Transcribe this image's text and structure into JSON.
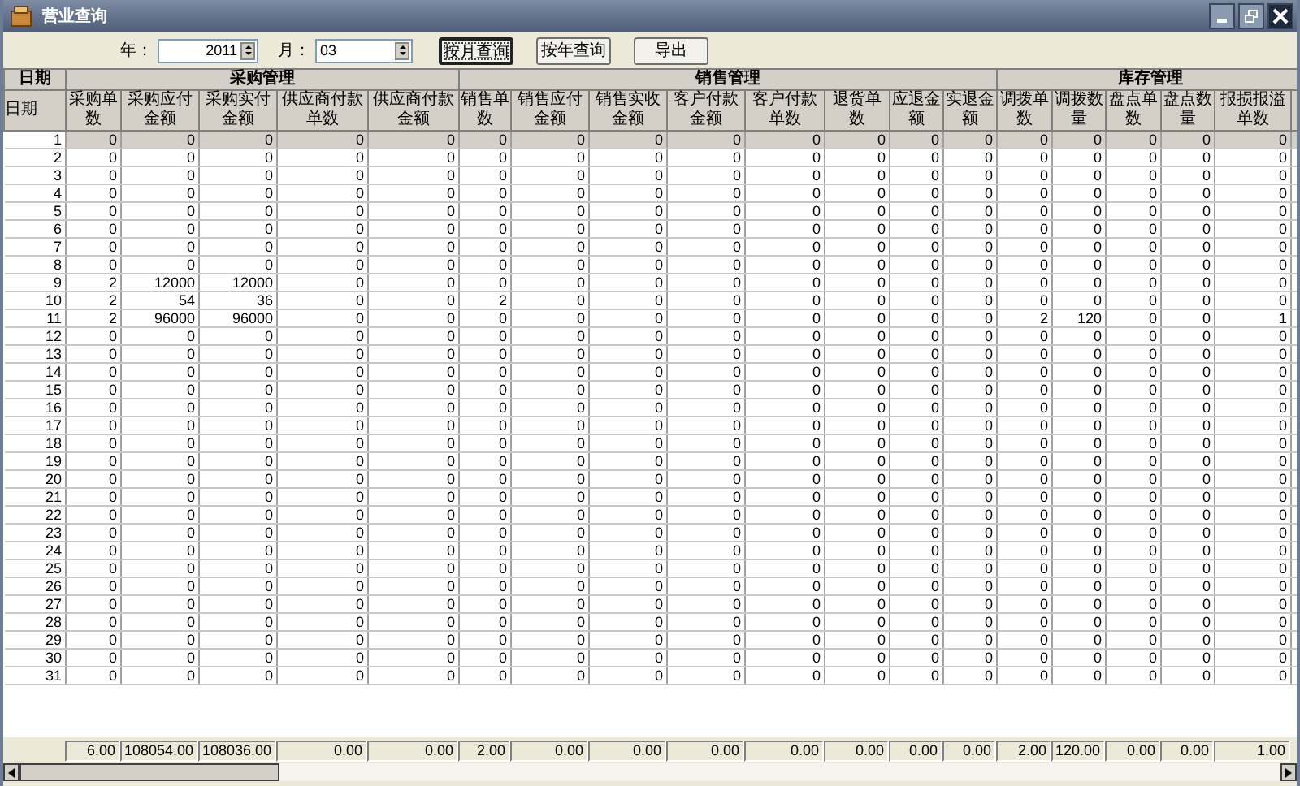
{
  "window": {
    "title": "营业查询"
  },
  "toolbar": {
    "year_label": "年：",
    "year_value": "2011",
    "month_label": "月：",
    "month_value": "03",
    "buttons": [
      {
        "label": "按月查询",
        "focused": true
      },
      {
        "label": "按年查询",
        "focused": false
      },
      {
        "label": "导出",
        "focused": false
      }
    ]
  },
  "table": {
    "groups": [
      {
        "label": "日期",
        "columns": [
          "日期"
        ]
      },
      {
        "label": "采购管理",
        "columns": [
          "采购单数",
          "采购应付金额",
          "采购实付金额",
          "供应商付款单数",
          "供应商付款金额"
        ]
      },
      {
        "label": "销售管理",
        "columns": [
          "销售单数",
          "销售应付金额",
          "销售实收金额",
          "客户付款金额",
          "客户付款单数",
          "退货单数",
          "应退金额",
          "实退金额"
        ]
      },
      {
        "label": "库存管理",
        "columns": [
          "调拨单数",
          "调拨数量",
          "盘点单数",
          "盘点数量",
          "报损报溢单数"
        ]
      }
    ],
    "rows": [
      {
        "selected": true,
        "cells": [
          "1",
          "0",
          "0",
          "0",
          "0",
          "0",
          "0",
          "0",
          "0",
          "0",
          "0",
          "0",
          "0",
          "0",
          "0",
          "0",
          "0",
          "0",
          "0"
        ]
      },
      {
        "selected": false,
        "cells": [
          "2",
          "0",
          "0",
          "0",
          "0",
          "0",
          "0",
          "0",
          "0",
          "0",
          "0",
          "0",
          "0",
          "0",
          "0",
          "0",
          "0",
          "0",
          "0"
        ]
      },
      {
        "selected": false,
        "cells": [
          "3",
          "0",
          "0",
          "0",
          "0",
          "0",
          "0",
          "0",
          "0",
          "0",
          "0",
          "0",
          "0",
          "0",
          "0",
          "0",
          "0",
          "0",
          "0"
        ]
      },
      {
        "selected": false,
        "cells": [
          "4",
          "0",
          "0",
          "0",
          "0",
          "0",
          "0",
          "0",
          "0",
          "0",
          "0",
          "0",
          "0",
          "0",
          "0",
          "0",
          "0",
          "0",
          "0"
        ]
      },
      {
        "selected": false,
        "cells": [
          "5",
          "0",
          "0",
          "0",
          "0",
          "0",
          "0",
          "0",
          "0",
          "0",
          "0",
          "0",
          "0",
          "0",
          "0",
          "0",
          "0",
          "0",
          "0"
        ]
      },
      {
        "selected": false,
        "cells": [
          "6",
          "0",
          "0",
          "0",
          "0",
          "0",
          "0",
          "0",
          "0",
          "0",
          "0",
          "0",
          "0",
          "0",
          "0",
          "0",
          "0",
          "0",
          "0"
        ]
      },
      {
        "selected": false,
        "cells": [
          "7",
          "0",
          "0",
          "0",
          "0",
          "0",
          "0",
          "0",
          "0",
          "0",
          "0",
          "0",
          "0",
          "0",
          "0",
          "0",
          "0",
          "0",
          "0"
        ]
      },
      {
        "selected": false,
        "cells": [
          "8",
          "0",
          "0",
          "0",
          "0",
          "0",
          "0",
          "0",
          "0",
          "0",
          "0",
          "0",
          "0",
          "0",
          "0",
          "0",
          "0",
          "0",
          "0"
        ]
      },
      {
        "selected": false,
        "cells": [
          "9",
          "2",
          "12000",
          "12000",
          "0",
          "0",
          "0",
          "0",
          "0",
          "0",
          "0",
          "0",
          "0",
          "0",
          "0",
          "0",
          "0",
          "0",
          "0"
        ]
      },
      {
        "selected": false,
        "cells": [
          "10",
          "2",
          "54",
          "36",
          "0",
          "0",
          "2",
          "0",
          "0",
          "0",
          "0",
          "0",
          "0",
          "0",
          "0",
          "0",
          "0",
          "0",
          "0"
        ]
      },
      {
        "selected": false,
        "cells": [
          "11",
          "2",
          "96000",
          "96000",
          "0",
          "0",
          "0",
          "0",
          "0",
          "0",
          "0",
          "0",
          "0",
          "0",
          "2",
          "120",
          "0",
          "0",
          "1"
        ]
      },
      {
        "selected": false,
        "cells": [
          "12",
          "0",
          "0",
          "0",
          "0",
          "0",
          "0",
          "0",
          "0",
          "0",
          "0",
          "0",
          "0",
          "0",
          "0",
          "0",
          "0",
          "0",
          "0"
        ]
      },
      {
        "selected": false,
        "cells": [
          "13",
          "0",
          "0",
          "0",
          "0",
          "0",
          "0",
          "0",
          "0",
          "0",
          "0",
          "0",
          "0",
          "0",
          "0",
          "0",
          "0",
          "0",
          "0"
        ]
      },
      {
        "selected": false,
        "cells": [
          "14",
          "0",
          "0",
          "0",
          "0",
          "0",
          "0",
          "0",
          "0",
          "0",
          "0",
          "0",
          "0",
          "0",
          "0",
          "0",
          "0",
          "0",
          "0"
        ]
      },
      {
        "selected": false,
        "cells": [
          "15",
          "0",
          "0",
          "0",
          "0",
          "0",
          "0",
          "0",
          "0",
          "0",
          "0",
          "0",
          "0",
          "0",
          "0",
          "0",
          "0",
          "0",
          "0"
        ]
      },
      {
        "selected": false,
        "cells": [
          "16",
          "0",
          "0",
          "0",
          "0",
          "0",
          "0",
          "0",
          "0",
          "0",
          "0",
          "0",
          "0",
          "0",
          "0",
          "0",
          "0",
          "0",
          "0"
        ]
      },
      {
        "selected": false,
        "cells": [
          "17",
          "0",
          "0",
          "0",
          "0",
          "0",
          "0",
          "0",
          "0",
          "0",
          "0",
          "0",
          "0",
          "0",
          "0",
          "0",
          "0",
          "0",
          "0"
        ]
      },
      {
        "selected": false,
        "cells": [
          "18",
          "0",
          "0",
          "0",
          "0",
          "0",
          "0",
          "0",
          "0",
          "0",
          "0",
          "0",
          "0",
          "0",
          "0",
          "0",
          "0",
          "0",
          "0"
        ]
      },
      {
        "selected": false,
        "cells": [
          "19",
          "0",
          "0",
          "0",
          "0",
          "0",
          "0",
          "0",
          "0",
          "0",
          "0",
          "0",
          "0",
          "0",
          "0",
          "0",
          "0",
          "0",
          "0"
        ]
      },
      {
        "selected": false,
        "cells": [
          "20",
          "0",
          "0",
          "0",
          "0",
          "0",
          "0",
          "0",
          "0",
          "0",
          "0",
          "0",
          "0",
          "0",
          "0",
          "0",
          "0",
          "0",
          "0"
        ]
      },
      {
        "selected": false,
        "cells": [
          "21",
          "0",
          "0",
          "0",
          "0",
          "0",
          "0",
          "0",
          "0",
          "0",
          "0",
          "0",
          "0",
          "0",
          "0",
          "0",
          "0",
          "0",
          "0"
        ]
      },
      {
        "selected": false,
        "cells": [
          "22",
          "0",
          "0",
          "0",
          "0",
          "0",
          "0",
          "0",
          "0",
          "0",
          "0",
          "0",
          "0",
          "0",
          "0",
          "0",
          "0",
          "0",
          "0"
        ]
      },
      {
        "selected": false,
        "cells": [
          "23",
          "0",
          "0",
          "0",
          "0",
          "0",
          "0",
          "0",
          "0",
          "0",
          "0",
          "0",
          "0",
          "0",
          "0",
          "0",
          "0",
          "0",
          "0"
        ]
      },
      {
        "selected": false,
        "cells": [
          "24",
          "0",
          "0",
          "0",
          "0",
          "0",
          "0",
          "0",
          "0",
          "0",
          "0",
          "0",
          "0",
          "0",
          "0",
          "0",
          "0",
          "0",
          "0"
        ]
      },
      {
        "selected": false,
        "cells": [
          "25",
          "0",
          "0",
          "0",
          "0",
          "0",
          "0",
          "0",
          "0",
          "0",
          "0",
          "0",
          "0",
          "0",
          "0",
          "0",
          "0",
          "0",
          "0"
        ]
      },
      {
        "selected": false,
        "cells": [
          "26",
          "0",
          "0",
          "0",
          "0",
          "0",
          "0",
          "0",
          "0",
          "0",
          "0",
          "0",
          "0",
          "0",
          "0",
          "0",
          "0",
          "0",
          "0"
        ]
      },
      {
        "selected": false,
        "cells": [
          "27",
          "0",
          "0",
          "0",
          "0",
          "0",
          "0",
          "0",
          "0",
          "0",
          "0",
          "0",
          "0",
          "0",
          "0",
          "0",
          "0",
          "0",
          "0"
        ]
      },
      {
        "selected": false,
        "cells": [
          "28",
          "0",
          "0",
          "0",
          "0",
          "0",
          "0",
          "0",
          "0",
          "0",
          "0",
          "0",
          "0",
          "0",
          "0",
          "0",
          "0",
          "0",
          "0"
        ]
      },
      {
        "selected": false,
        "cells": [
          "29",
          "0",
          "0",
          "0",
          "0",
          "0",
          "0",
          "0",
          "0",
          "0",
          "0",
          "0",
          "0",
          "0",
          "0",
          "0",
          "0",
          "0",
          "0"
        ]
      },
      {
        "selected": false,
        "cells": [
          "30",
          "0",
          "0",
          "0",
          "0",
          "0",
          "0",
          "0",
          "0",
          "0",
          "0",
          "0",
          "0",
          "0",
          "0",
          "0",
          "0",
          "0",
          "0"
        ]
      },
      {
        "selected": false,
        "cells": [
          "31",
          "0",
          "0",
          "0",
          "0",
          "0",
          "0",
          "0",
          "0",
          "0",
          "0",
          "0",
          "0",
          "0",
          "0",
          "0",
          "0",
          "0",
          "0"
        ]
      }
    ],
    "totals": [
      "6.00",
      "108054.00",
      "108036.00",
      "0.00",
      "0.00",
      "2.00",
      "0.00",
      "0.00",
      "0.00",
      "0.00",
      "0.00",
      "0.00",
      "0.00",
      "2.00",
      "120.00",
      "0.00",
      "0.00",
      "1.00"
    ]
  }
}
